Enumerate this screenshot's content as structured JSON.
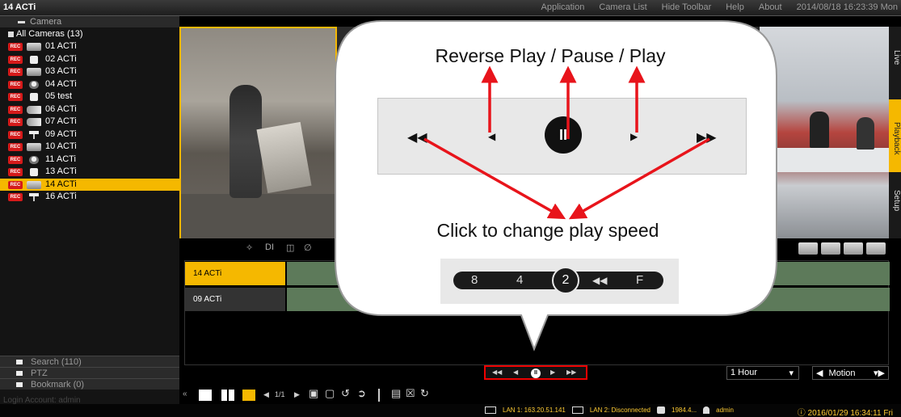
{
  "app": {
    "title": "14 ACTi"
  },
  "menu": [
    "Application",
    "Camera List",
    "Hide Toolbar",
    "Help",
    "About",
    "2014/08/18 16:23:39 Mon"
  ],
  "sidebar": {
    "header": "Camera",
    "all_cameras": "All Cameras (13)",
    "rec_badge": "REC",
    "cameras": [
      {
        "name": "01  ACTi",
        "icon": "box-camera-icon"
      },
      {
        "name": "02  ACTi",
        "icon": "cube-camera-icon"
      },
      {
        "name": "03  ACTi",
        "icon": "box-camera-icon"
      },
      {
        "name": "04  ACTi",
        "icon": "dome-camera-icon"
      },
      {
        "name": "05  test",
        "icon": "cube-camera-icon"
      },
      {
        "name": "06  ACTi",
        "icon": "bullet-camera-icon"
      },
      {
        "name": "07  ACTi",
        "icon": "bullet-camera-icon"
      },
      {
        "name": "09  ACTi",
        "icon": "pole-camera-icon"
      },
      {
        "name": "10  ACTi",
        "icon": "box-camera-icon"
      },
      {
        "name": "11  ACTi",
        "icon": "dome-camera-icon"
      },
      {
        "name": "13  ACTi",
        "icon": "cube-camera-icon"
      },
      {
        "name": "14  ACTi",
        "icon": "box-camera-icon",
        "selected": true
      },
      {
        "name": "16  ACTi",
        "icon": "pole-camera-icon"
      }
    ],
    "footer_tabs": [
      "Search (110)",
      "PTZ",
      "Bookmark (0)"
    ],
    "login": "Login Account: admin"
  },
  "view_tabs": [
    "Live",
    "Playback",
    "Setup"
  ],
  "event_icons": [
    "DI"
  ],
  "timeline": {
    "tracks": [
      "14 ACTi",
      "09 ACTi"
    ]
  },
  "range_select": "1 Hour",
  "filter_select": "Motion",
  "toolbar": {
    "page": "1/1"
  },
  "status": {
    "lan1": "LAN 1: 163.20.51.141",
    "lan2": "LAN 2: Disconnected",
    "disk": "1984.4...",
    "user": "admin",
    "datetime": "2016/01/29 16:34:11 Fri"
  },
  "callout": {
    "title": "Reverse Play / Pause / Play",
    "subtitle": "Click to change play speed",
    "speeds": [
      "8",
      "4",
      "2",
      "F"
    ],
    "selected_speed": "2"
  },
  "colors": {
    "accent": "#f5b800",
    "rec": "#d51a1a",
    "arrow": "#e8141b"
  }
}
